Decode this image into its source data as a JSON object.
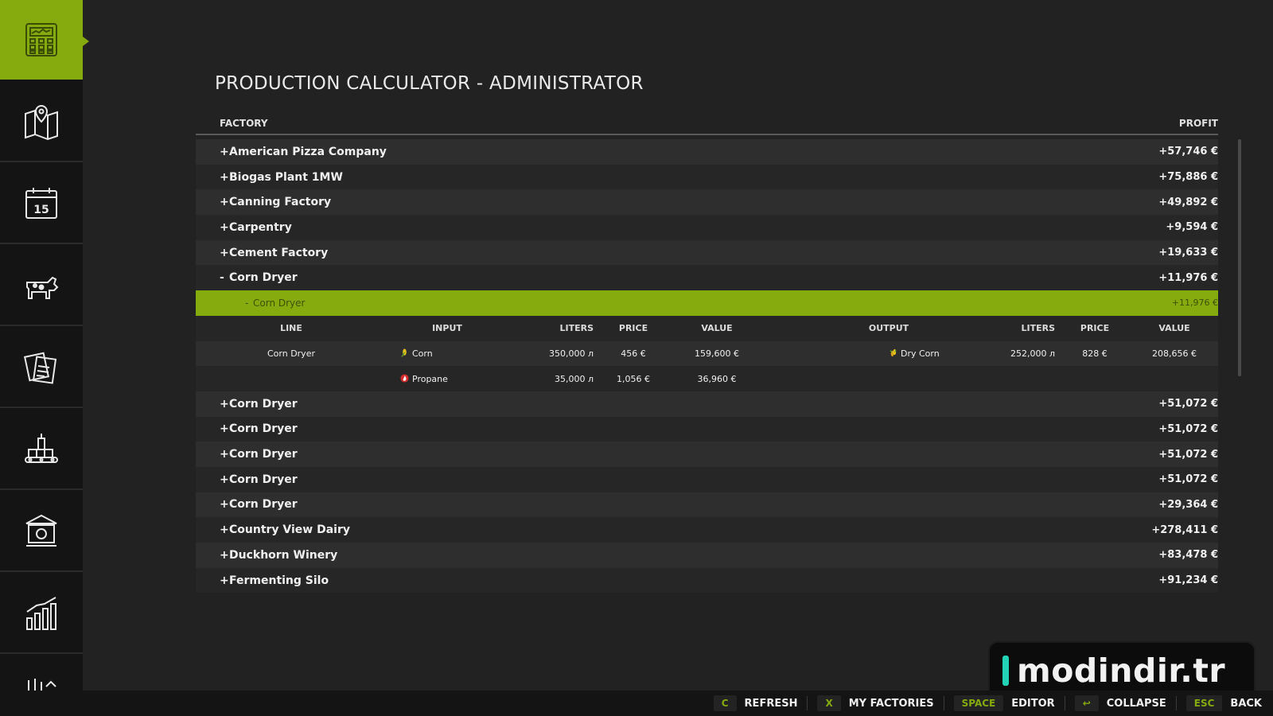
{
  "title": "PRODUCTION CALCULATOR - ADMINISTRATOR",
  "sidebar": {
    "items": [
      {
        "icon": "calculator-icon",
        "active": true
      },
      {
        "icon": "map-icon"
      },
      {
        "icon": "calendar-icon",
        "text": "15"
      },
      {
        "icon": "cow-icon"
      },
      {
        "icon": "contracts-icon"
      },
      {
        "icon": "production-icon"
      },
      {
        "icon": "bank-icon"
      },
      {
        "icon": "statistics-icon"
      },
      {
        "icon": "more-icon"
      }
    ]
  },
  "table": {
    "header_factory": "FACTORY",
    "header_profit": "PROFIT",
    "rows_before": [
      {
        "prefix": "+",
        "name": "American Pizza Company",
        "profit": "+57,746 €"
      },
      {
        "prefix": "+",
        "name": "Biogas Plant 1MW",
        "profit": "+75,886 €"
      },
      {
        "prefix": "+",
        "name": "Canning Factory",
        "profit": "+49,892 €"
      },
      {
        "prefix": "+",
        "name": "Carpentry",
        "profit": "+9,594 €"
      },
      {
        "prefix": "+",
        "name": "Cement Factory",
        "profit": "+19,633 €"
      },
      {
        "prefix": "-",
        "name": "Corn Dryer",
        "profit": "+11,976 €"
      }
    ],
    "selected": {
      "prefix": "-",
      "name": "Corn Dryer",
      "profit": "+11,976 €"
    },
    "detail_header": {
      "line": "LINE",
      "input": "INPUT",
      "liters": "LITERS",
      "price": "PRICE",
      "value": "VALUE",
      "output": "OUTPUT",
      "out_liters": "LITERS",
      "out_price": "PRICE",
      "out_value": "VALUE"
    },
    "detail_rows": [
      {
        "line": "Corn Dryer",
        "input": "Corn",
        "liters": "350,000 л",
        "price": "456 €",
        "value": "159,600 €",
        "output": "Dry Corn",
        "out_liters": "252,000 л",
        "out_price": "828 €",
        "out_value": "208,656 €"
      },
      {
        "line": "",
        "input": "Propane",
        "liters": "35,000 л",
        "price": "1,056 €",
        "value": "36,960 €",
        "output": "",
        "out_liters": "",
        "out_price": "",
        "out_value": ""
      }
    ],
    "rows_after": [
      {
        "prefix": "+",
        "name": "Corn Dryer",
        "profit": "+51,072 €"
      },
      {
        "prefix": "+",
        "name": "Corn Dryer",
        "profit": "+51,072 €"
      },
      {
        "prefix": "+",
        "name": "Corn Dryer",
        "profit": "+51,072 €"
      },
      {
        "prefix": "+",
        "name": "Corn Dryer",
        "profit": "+51,072 €"
      },
      {
        "prefix": "+",
        "name": "Corn Dryer",
        "profit": "+29,364 €"
      },
      {
        "prefix": "+",
        "name": "Country View Dairy",
        "profit": "+278,411 €"
      },
      {
        "prefix": "+",
        "name": "Duckhorn Winery",
        "profit": "+83,478 €"
      },
      {
        "prefix": "+",
        "name": "Fermenting Silo",
        "profit": "+91,234 €"
      }
    ]
  },
  "watermark": "modindir.tr",
  "bottombar": {
    "hints": [
      {
        "key": "C",
        "label": "REFRESH"
      },
      {
        "key": "X",
        "label": "MY FACTORIES"
      },
      {
        "key": "SPACE",
        "label": "EDITOR"
      },
      {
        "key": "↩",
        "label": "COLLAPSE"
      },
      {
        "key": "ESC",
        "label": "BACK"
      }
    ]
  },
  "colors": {
    "accent": "#86ab0f",
    "background": "#222222",
    "sidebar": "#141414"
  }
}
